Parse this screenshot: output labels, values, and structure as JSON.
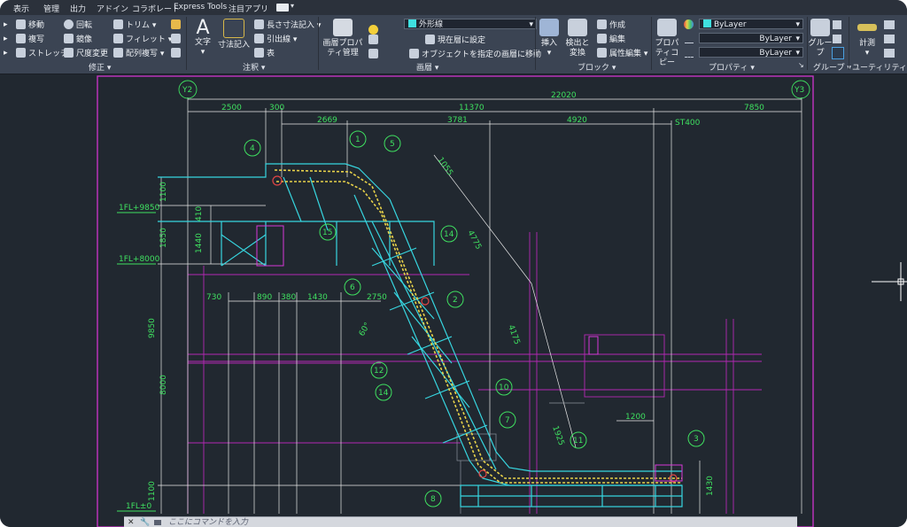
{
  "tabs": [
    "表示",
    "管理",
    "出力",
    "アドイン",
    "コラボレート",
    "Express Tools",
    "注目アプリ"
  ],
  "ribbon": {
    "modify": {
      "label": "修正",
      "items": [
        "移動",
        "回転",
        "トリム",
        "複写",
        "鏡像",
        "フィレット",
        "ストレッチ",
        "尺度変更",
        "配列複写"
      ]
    },
    "annotation": {
      "label": "注釈",
      "text": "文字",
      "dimension": "寸法記入",
      "linear": "長さ寸法記入",
      "leader": "引出線",
      "table": "表"
    },
    "layers": {
      "label": "画層",
      "props": "画層プロパティ管理",
      "current_layer": "外形線",
      "set_current": "現在層に設定",
      "match": "オブジェクトを指定の画層に移動"
    },
    "block": {
      "label": "ブロック",
      "insert": "挿入",
      "detect": "検出と変換",
      "create": "作成",
      "edit": "編集",
      "attr": "属性編集"
    },
    "properties": {
      "label": "プロパティ",
      "copy": "プロパティコピー",
      "color": "ByLayer",
      "linetype": "ByLayer",
      "lineweight": "ByLayer"
    },
    "groups": {
      "label": "グループ",
      "group": "グループ"
    },
    "utilities": {
      "label": "ユーティリティ",
      "measure": "計測"
    }
  },
  "drawing": {
    "grid": [
      "Y2",
      "Y3"
    ],
    "top_dims": [
      "22020",
      "2500",
      "300",
      "11370",
      "7850",
      "2669",
      "3781",
      "4920",
      "ST400"
    ],
    "mid_dims": [
      "730",
      "890",
      "380",
      "1430",
      "2750"
    ],
    "left_dims": [
      "1100",
      "410",
      "1850",
      "1440",
      "9850",
      "8000",
      "1100"
    ],
    "other_dims": [
      "1200",
      "1430",
      "4775",
      "4175",
      "1925",
      "1055",
      "60°"
    ],
    "levels": [
      "1FL+9850",
      "1FL+8000",
      "1FL±0"
    ],
    "callouts": [
      "1",
      "2",
      "3",
      "4",
      "5",
      "6",
      "7",
      "8",
      "10",
      "11",
      "12",
      "14",
      "14",
      "15"
    ]
  },
  "command": {
    "placeholder": "ここにコマンドを入力"
  }
}
